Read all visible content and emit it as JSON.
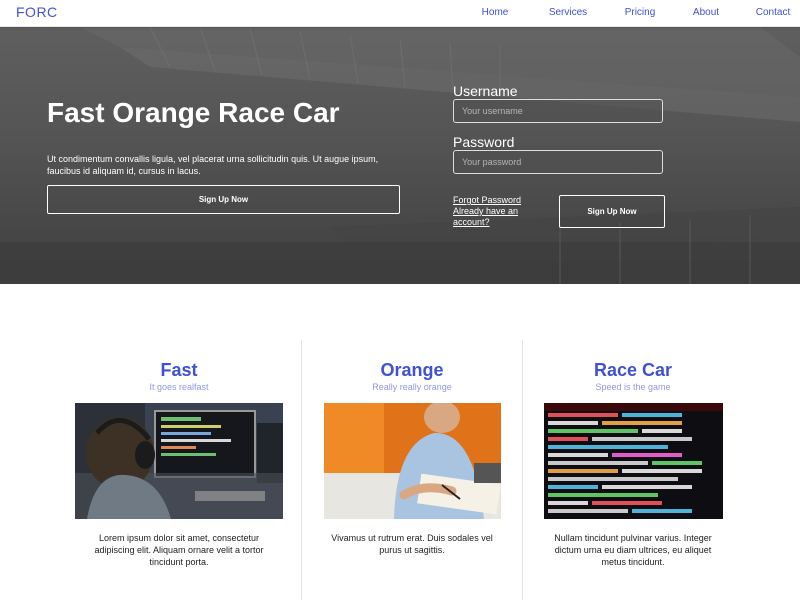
{
  "nav": {
    "brand": "FORC",
    "links": [
      "Home",
      "Services",
      "Pricing",
      "About",
      "Contact"
    ]
  },
  "hero": {
    "title": "Fast Orange Race Car",
    "text": "Ut condimentum convallis ligula, vel placerat urna sollicitudin quis. Ut augue ipsum, faucibus id aliquam id, cursus in lacus.",
    "signup_label": "Sign Up Now"
  },
  "login": {
    "username_label": "Username",
    "username_placeholder": "Your username",
    "password_label": "Password",
    "password_placeholder": "Your password",
    "forgot_label": "Forgot Password",
    "account_label": "Already have an account?",
    "signup_label": "Sign Up Now"
  },
  "features": [
    {
      "title": "Fast",
      "subtitle": "It goes realfast",
      "text": "Lorem ipsum dolor sit amet, consectetur adipiscing elit. Aliquam ornare velit a tortor tincidunt porta.",
      "image": "person-with-headphones-at-computer"
    },
    {
      "title": "Orange",
      "subtitle": "Really really orange",
      "text": "Vivamus ut rutrum erat. Duis sodales vel purus ut sagittis.",
      "image": "person-writing-at-desk-orange-wall"
    },
    {
      "title": "Race Car",
      "subtitle": "Speed is the game",
      "text": "Nullam tincidunt pulvinar varius. Integer dictum urna eu diam ultrices, eu aliquet metus tincidunt.",
      "image": "colorful-source-code-screen"
    }
  ],
  "colors": {
    "accent": "#3f51d6",
    "subtitle": "#8f98e6",
    "hero_bg": "#555555"
  }
}
